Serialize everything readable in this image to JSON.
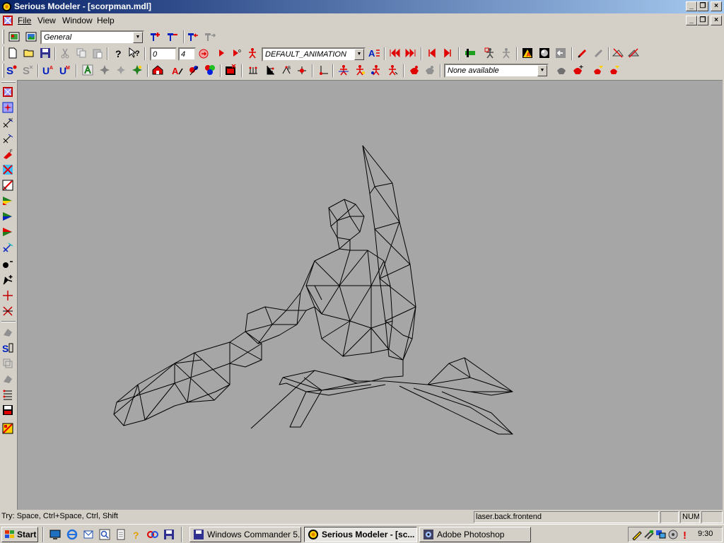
{
  "window": {
    "title": "Serious Modeler - [scorpman.mdl]",
    "caption_buttons": [
      "minimize",
      "restore",
      "close"
    ]
  },
  "menu": {
    "items": [
      "File",
      "View",
      "Window",
      "Help"
    ],
    "mdi_buttons": [
      "minimize",
      "restore",
      "close"
    ]
  },
  "toolbar1": {
    "mode_combo": "General"
  },
  "toolbar2": {
    "frame_field": "0",
    "step_field": "4",
    "animation_combo": "DEFAULT_ANIMATION"
  },
  "toolbar3": {
    "attachment_combo": "None available"
  },
  "statusbar": {
    "hint": "Try: Space, Ctrl+Space, Ctrl, Shift",
    "texture": "laser.back.frontend",
    "pane_empty": "",
    "num": "NUM"
  },
  "taskbar": {
    "start": "Start",
    "tasks": [
      "Windows Commander 5....",
      "Serious Modeler - [sc...",
      "Adobe Photoshop"
    ],
    "active_task": "Serious Modeler - [sc...",
    "clock": "9:30"
  },
  "icons": {
    "app": "sun-icon",
    "colors": {
      "accent_red": "#e00000",
      "accent_blue": "#0020c0",
      "viewport_bg": "#a6a6a6",
      "titlebar": "#0a246a"
    }
  }
}
